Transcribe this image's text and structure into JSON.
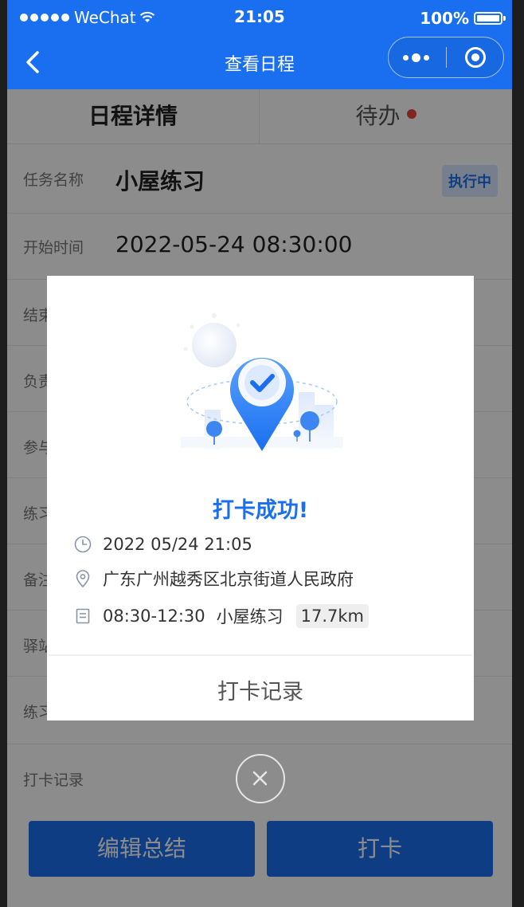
{
  "status_bar": {
    "carrier": "WeChat",
    "time": "21:05",
    "battery": "100%"
  },
  "nav": {
    "title": "查看日程",
    "back_icon": "chevron-left-icon",
    "more_icon": "more-dots-icon",
    "target_icon": "target-icon"
  },
  "tabs": [
    {
      "label": "日程详情",
      "active": true
    },
    {
      "label": "待办",
      "active": false,
      "has_dot": true
    }
  ],
  "detail": {
    "task_name_label": "任务名称",
    "task_name": "小屋练习",
    "status_badge": "执行中",
    "start_time_label": "开始时间",
    "start_time": "2022-05-24 08:30:00",
    "row_labels_partial": [
      "结束",
      "负责",
      "参与",
      "练习",
      "备注",
      "驿站",
      "练习"
    ],
    "checkin_record_label": "打卡记录"
  },
  "buttons": {
    "summary": "编辑总结",
    "checkin": "打卡"
  },
  "modal": {
    "title": "打卡成功!",
    "datetime": "2022 05/24 21:05",
    "location": "广东广州越秀区北京街道人民政府",
    "time_range": "08:30-12:30",
    "task": "小屋练习",
    "distance": "17.7km",
    "record_link": "打卡记录"
  },
  "colors": {
    "primary": "#1a6ff0",
    "badge_bg": "#d9e8ff",
    "dot": "#e8453c"
  }
}
